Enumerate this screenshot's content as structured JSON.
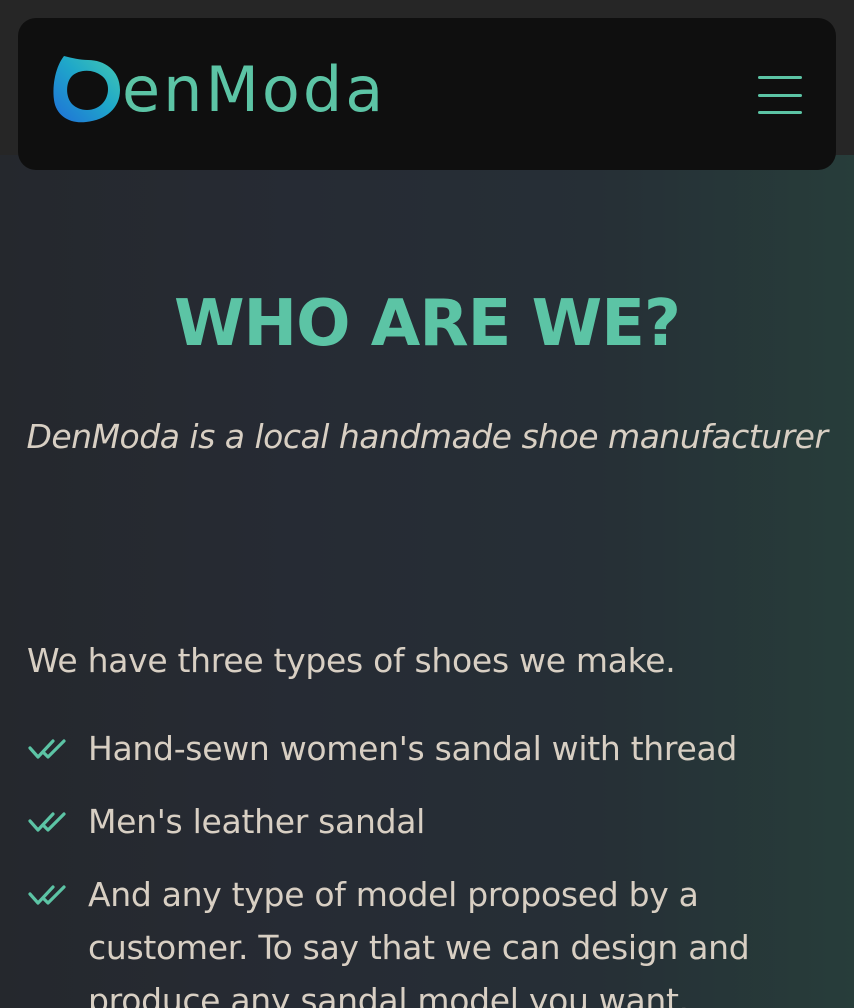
{
  "brand": {
    "name": "enModa",
    "logo_icon": "denmoda-logo-mark",
    "accent_color": "#5cc4a5"
  },
  "nav": {
    "menu_icon": "hamburger-menu-icon"
  },
  "hero": {
    "title": "WHO ARE WE?",
    "subtitle": "DenModa is a local handmade shoe manufacturer"
  },
  "about": {
    "intro": "We have three types of shoes we make.",
    "items": [
      {
        "icon": "double-check-icon",
        "text": "Hand-sewn women's sandal with thread"
      },
      {
        "icon": "double-check-icon",
        "text": "Men's leather sandal"
      },
      {
        "icon": "double-check-icon",
        "text": "And any type of model proposed by a customer. To say that we can design and produce any sandal model you want."
      }
    ]
  }
}
